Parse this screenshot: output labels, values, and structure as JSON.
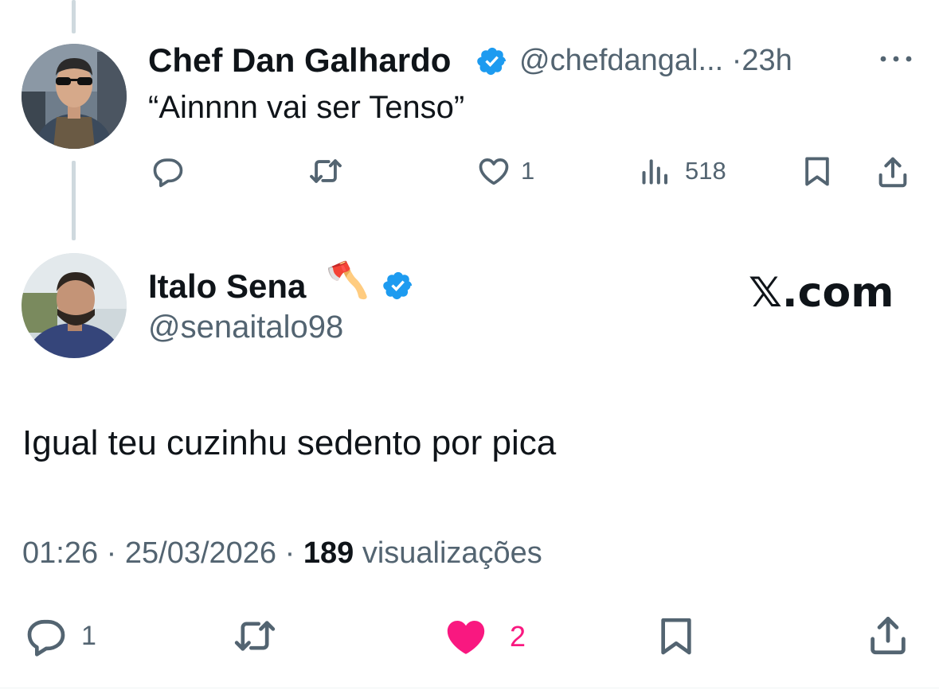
{
  "reply_to": {
    "display_name": "Chef Dan Galhardo",
    "handle": "@chefdangal...",
    "separator": "·",
    "time_ago": "23h",
    "text": "“Ainnnn vai ser Tenso”",
    "actions": {
      "reply_count": "",
      "repost_count": "",
      "like_count": "1",
      "views_count": "518"
    }
  },
  "tweet": {
    "display_name": "Italo Sena",
    "name_emoji": "🪓",
    "handle": "@senaitalo98",
    "watermark": "𝕏.com",
    "text": "Igual teu cuzinhu sedento por pica",
    "meta": {
      "time": "01:26",
      "sep1": "·",
      "date": "25/03/2026",
      "sep2": "·",
      "views_number": "189",
      "views_label": "visualizações"
    },
    "actions": {
      "reply_count": "1",
      "like_count": "2",
      "liked": true
    }
  },
  "colors": {
    "verified": "#1d9bf0",
    "like": "#f91880",
    "text": "#0f1419",
    "muted": "#536471",
    "thread_line": "#cfd9de"
  },
  "icons": [
    "reply-icon",
    "repost-icon",
    "like-icon",
    "views-icon",
    "bookmark-icon",
    "share-icon",
    "verified-badge-icon",
    "more-icon",
    "axe-icon"
  ]
}
